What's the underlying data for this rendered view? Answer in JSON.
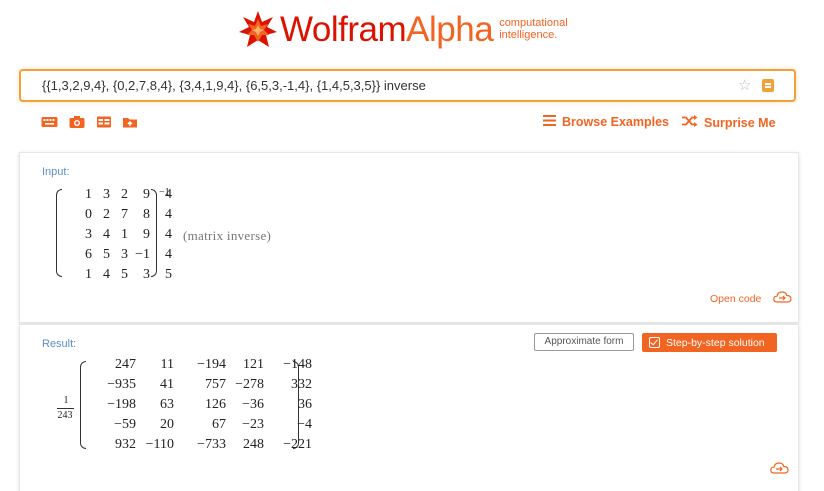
{
  "logo": {
    "wolfram": "Wolfram",
    "alpha": "Alpha",
    "tagline_1": "computational",
    "tagline_2": "intelligence."
  },
  "search": {
    "query": "{{1,3,2,9,4}, {0,2,7,8,4}, {3,4,1,9,4}, {6,5,3,-1,4}, {1,4,5,3,5}} inverse"
  },
  "toolbar": {
    "browse_label": "Browse Examples",
    "surprise_label": "Surprise Me",
    "icons": [
      "keyboard-icon",
      "camera-icon",
      "table-icon",
      "folder-upload-icon"
    ]
  },
  "input_pod": {
    "title": "Input:",
    "matrix": [
      [
        "1",
        "3",
        "2",
        "9",
        "4"
      ],
      [
        "0",
        "2",
        "7",
        "8",
        "4"
      ],
      [
        "3",
        "4",
        "1",
        "9",
        "4"
      ],
      [
        "6",
        "5",
        "3",
        "−1",
        "4"
      ],
      [
        "1",
        "4",
        "5",
        "3",
        "5"
      ]
    ],
    "exponent": "−1",
    "note": "(matrix inverse)",
    "open_code": "Open code"
  },
  "result_pod": {
    "title": "Result:",
    "approximate_label": "Approximate form",
    "step_label": "Step-by-step solution",
    "fraction": {
      "numerator": "1",
      "denominator": "243"
    },
    "matrix": [
      [
        "247",
        "11",
        "−194",
        "121",
        "−148"
      ],
      [
        "−935",
        "41",
        "757",
        "−278",
        "332"
      ],
      [
        "−198",
        "63",
        "126",
        "−36",
        "36"
      ],
      [
        "−59",
        "20",
        "67",
        "−23",
        "−4"
      ],
      [
        "932",
        "−110",
        "−733",
        "248",
        "−221"
      ]
    ]
  },
  "colors": {
    "brand_red": "#dd1100",
    "brand_orange": "#f26422",
    "search_border": "#f4a03a",
    "pod_title": "#5a8ecf"
  }
}
